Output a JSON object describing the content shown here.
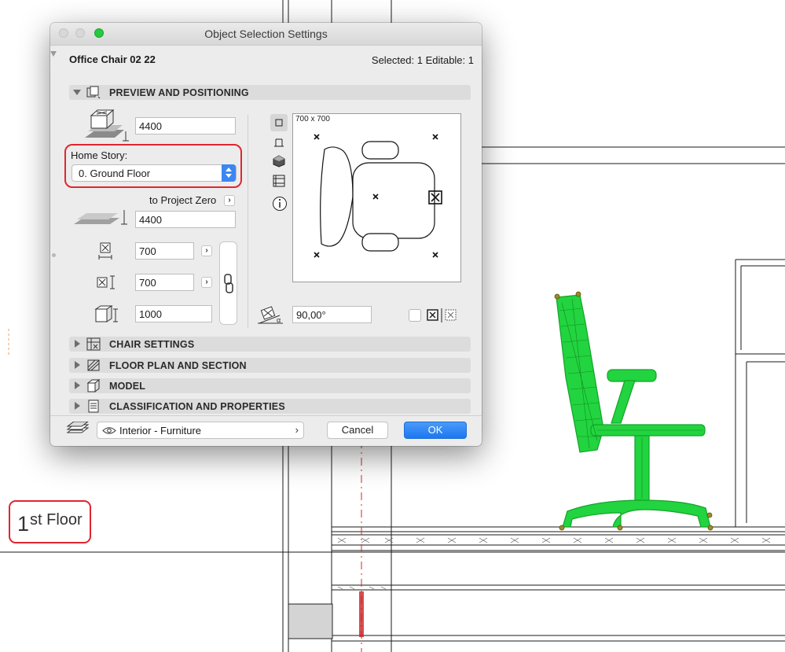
{
  "dialog": {
    "title": "Object Selection Settings",
    "object_name": "Office Chair 02 22",
    "selection_info": "Selected: 1 Editable: 1"
  },
  "sections": [
    {
      "title": "PREVIEW AND POSITIONING",
      "expanded": true,
      "icon": "preview-icon"
    },
    {
      "title": "CHAIR SETTINGS",
      "expanded": false,
      "icon": "chair-settings-icon"
    },
    {
      "title": "FLOOR PLAN AND SECTION",
      "expanded": false,
      "icon": "floor-plan-icon"
    },
    {
      "title": "MODEL",
      "expanded": false,
      "icon": "model-icon"
    },
    {
      "title": "CLASSIFICATION AND PROPERTIES",
      "expanded": false,
      "icon": "classification-icon"
    }
  ],
  "positioning": {
    "elevation_value": "4400",
    "home_story_label": "Home Story:",
    "home_story_value": "0. Ground Floor",
    "to_project_zero_label": "to Project Zero",
    "project_zero_value": "4400",
    "x_size": "700",
    "y_size": "700",
    "height": "1000",
    "rotation_angle": "90,00°",
    "preview_size_label": "700 x 700",
    "mirror_checked": false
  },
  "footer": {
    "classification": "Interior - Furniture",
    "cancel_label": "Cancel",
    "ok_label": "OK"
  },
  "drawing": {
    "floor_label_number": "1",
    "floor_label_suffix": "st Floor"
  },
  "colors": {
    "accent": "#3b87f1",
    "highlight": "#e0262f",
    "chair_green": "#1fcf3a"
  }
}
